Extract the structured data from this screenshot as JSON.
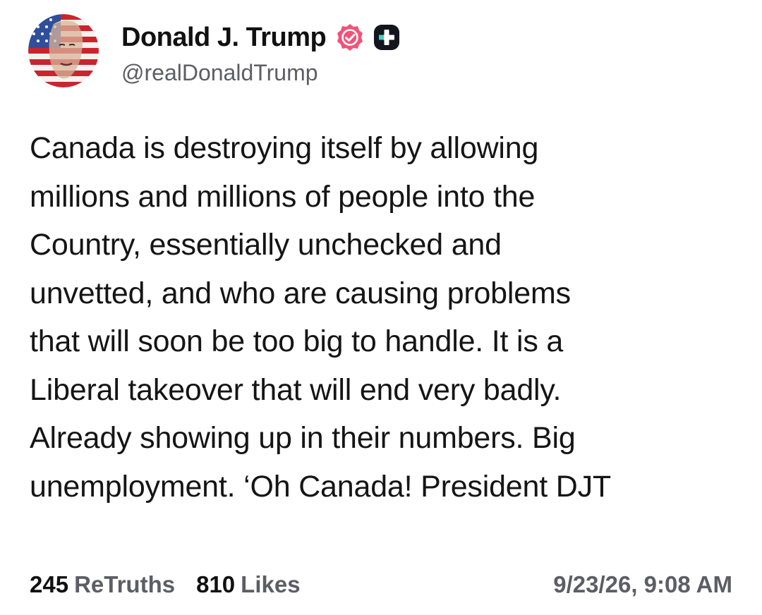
{
  "post": {
    "author": {
      "display_name": "Donald J. Trump",
      "handle": "@realDonaldTrump",
      "verified_badge_icon": "verified-badge-icon",
      "verified_badge_color": "#f0537a",
      "plus_badge_icon": "plus-badge-icon"
    },
    "body": "Canada is destroying itself by allowing\nmillions and millions of people into the\nCountry, essentially unchecked and\nunvetted, and who are causing problems\nthat will soon be too big to handle. It is a\nLiberal takeover that will end very badly.\nAlready showing up in their numbers. Big\nunemployment. ‘Oh Canada! President DJT",
    "stats": {
      "retruths_count": "245",
      "retruths_label": "ReTruths",
      "likes_count": "810",
      "likes_label": "Likes"
    },
    "timestamp": "9/23/26, 9:08 AM"
  }
}
